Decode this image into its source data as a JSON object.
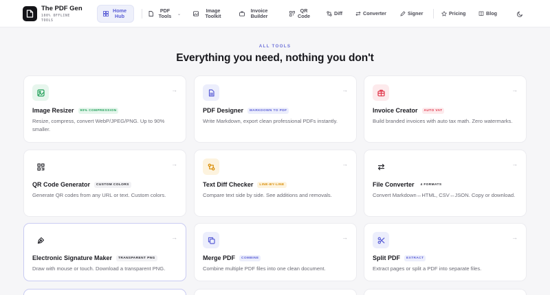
{
  "brand": {
    "title": "The PDF Gen",
    "subtitle": "100% OFFLINE TOOLS"
  },
  "nav": {
    "home": "Home Hub",
    "pdf_tools": "PDF Tools",
    "image_toolkit": "Image Toolkit",
    "invoice_builder": "Invoice Builder",
    "qr_code": "QR Code",
    "diff": "Diff",
    "converter": "Converter",
    "signer": "Signer",
    "pricing": "Pricing",
    "blog": "Blog"
  },
  "hero": {
    "eyebrow": "ALL TOOLS",
    "headline": "Everything you need, nothing you don't"
  },
  "tools": [
    {
      "name": "Image Resizer",
      "tag": "90% COMPRESSION",
      "desc": "Resize, compress, convert WebP/JPEG/PNG. Up to 90% smaller.",
      "icon": "image-icon",
      "tag_color": "#22a05a",
      "tag_bg": "#e5f6ec",
      "icon_bg": "#e7f6ed",
      "icon_color": "#22a05a"
    },
    {
      "name": "PDF Designer",
      "tag": "MARKDOWN TO PDF",
      "desc": "Write Markdown, export clean professional PDFs instantly.",
      "icon": "document-icon",
      "tag_color": "#5b5fd6",
      "tag_bg": "#eceefc",
      "icon_bg": "#eceefc",
      "icon_color": "#5b5fd6"
    },
    {
      "name": "Invoice Creator",
      "tag": "AUTO VAT",
      "desc": "Build branded invoices with auto tax math. Zero watermarks.",
      "icon": "briefcase-icon",
      "tag_color": "#e0364a",
      "tag_bg": "#fdeaec",
      "icon_bg": "#fdeaec",
      "icon_color": "#e0364a"
    },
    {
      "name": "QR Code Generator",
      "tag": "CUSTOM COLORS",
      "desc": "Generate QR codes from any URL or text. Custom colors.",
      "icon": "qr-code-icon",
      "tag_color": "#2a2a30",
      "tag_bg": "#f1f1f4",
      "icon_bg": "#ffffff",
      "icon_color": "#2a2a30"
    },
    {
      "name": "Text Diff Checker",
      "tag": "LINE-BY-LINE",
      "desc": "Compare text side by side. See additions and removals.",
      "icon": "diff-icon",
      "tag_color": "#d88a00",
      "tag_bg": "#fdf3de",
      "icon_bg": "#fdf3de",
      "icon_color": "#d88a00"
    },
    {
      "name": "File Converter",
      "tag": "4 FORMATS",
      "desc": "Convert Markdown↔HTML, CSV↔JSON. Copy or download.",
      "icon": "swap-arrows-icon",
      "tag_color": "#2a2a30",
      "tag_bg": "#ffffff",
      "icon_bg": "#ffffff",
      "icon_color": "#2a2a30"
    },
    {
      "name": "Electronic Signature Maker",
      "tag": "TRANSPARENT PNG",
      "desc": "Draw with mouse or touch. Download a transparent PNG.",
      "icon": "pen-nib-icon",
      "tag_color": "#2a2a30",
      "tag_bg": "#f1f1f4",
      "icon_bg": "#ffffff",
      "icon_color": "#2a2a30"
    },
    {
      "name": "Merge PDF",
      "tag": "COMBINE",
      "desc": "Combine multiple PDF files into one clean document.",
      "icon": "copy-icon",
      "tag_color": "#5b5fd6",
      "tag_bg": "#eceefc",
      "icon_bg": "#eceefc",
      "icon_color": "#5b5fd6"
    },
    {
      "name": "Split PDF",
      "tag": "EXTRACT",
      "desc": "Extract pages or split a PDF into separate files.",
      "icon": "scissors-icon",
      "tag_color": "#5b5fd6",
      "tag_bg": "#eceefc",
      "icon_bg": "#eceefc",
      "icon_color": "#5b5fd6"
    }
  ]
}
